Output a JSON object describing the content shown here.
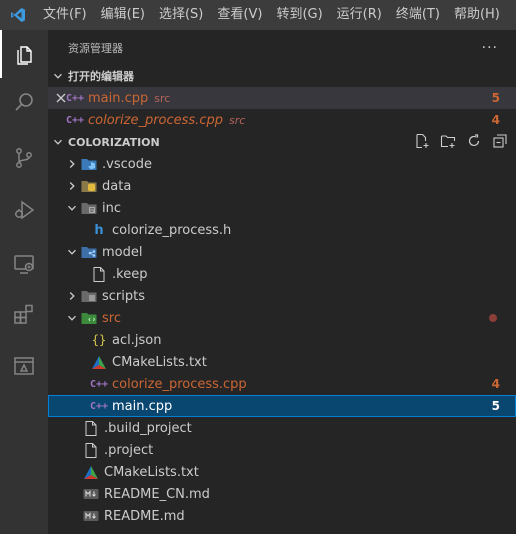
{
  "menu": {
    "items": [
      "文件(F)",
      "编辑(E)",
      "选择(S)",
      "查看(V)",
      "转到(G)",
      "运行(R)",
      "终端(T)",
      "帮助(H)"
    ]
  },
  "activitybar": {
    "items": [
      "explorer-icon",
      "search-icon",
      "source-control-icon",
      "run-debug-icon",
      "remote-explorer-icon",
      "extensions-icon",
      "ascend-icon"
    ]
  },
  "sidebar": {
    "title": "资源管理器",
    "more": "···",
    "open_editors": {
      "title": "打开的编辑器",
      "items": [
        {
          "name": "main.cpp",
          "desc": "src",
          "count": "5"
        },
        {
          "name": "colorize_process.cpp",
          "desc": "src",
          "count": "4"
        }
      ]
    },
    "workspace": {
      "title": "COLORIZATION",
      "items": [
        {
          "name": ".vscode"
        },
        {
          "name": "data"
        },
        {
          "name": "inc"
        },
        {
          "name": "colorize_process.h"
        },
        {
          "name": "model"
        },
        {
          "name": ".keep"
        },
        {
          "name": "scripts"
        },
        {
          "name": "src"
        },
        {
          "name": "acl.json"
        },
        {
          "name": "CMakeLists.txt"
        },
        {
          "name": "colorize_process.cpp",
          "count": "4"
        },
        {
          "name": "main.cpp",
          "count": "5"
        },
        {
          "name": ".build_project"
        },
        {
          "name": ".project"
        },
        {
          "name": "CMakeLists.txt"
        },
        {
          "name": "README_CN.md"
        },
        {
          "name": "README.md"
        }
      ]
    }
  },
  "colors": {
    "accent": "#007acc",
    "selection": "#094771",
    "warning": "#cc6633",
    "cpp": "#a074c4"
  }
}
